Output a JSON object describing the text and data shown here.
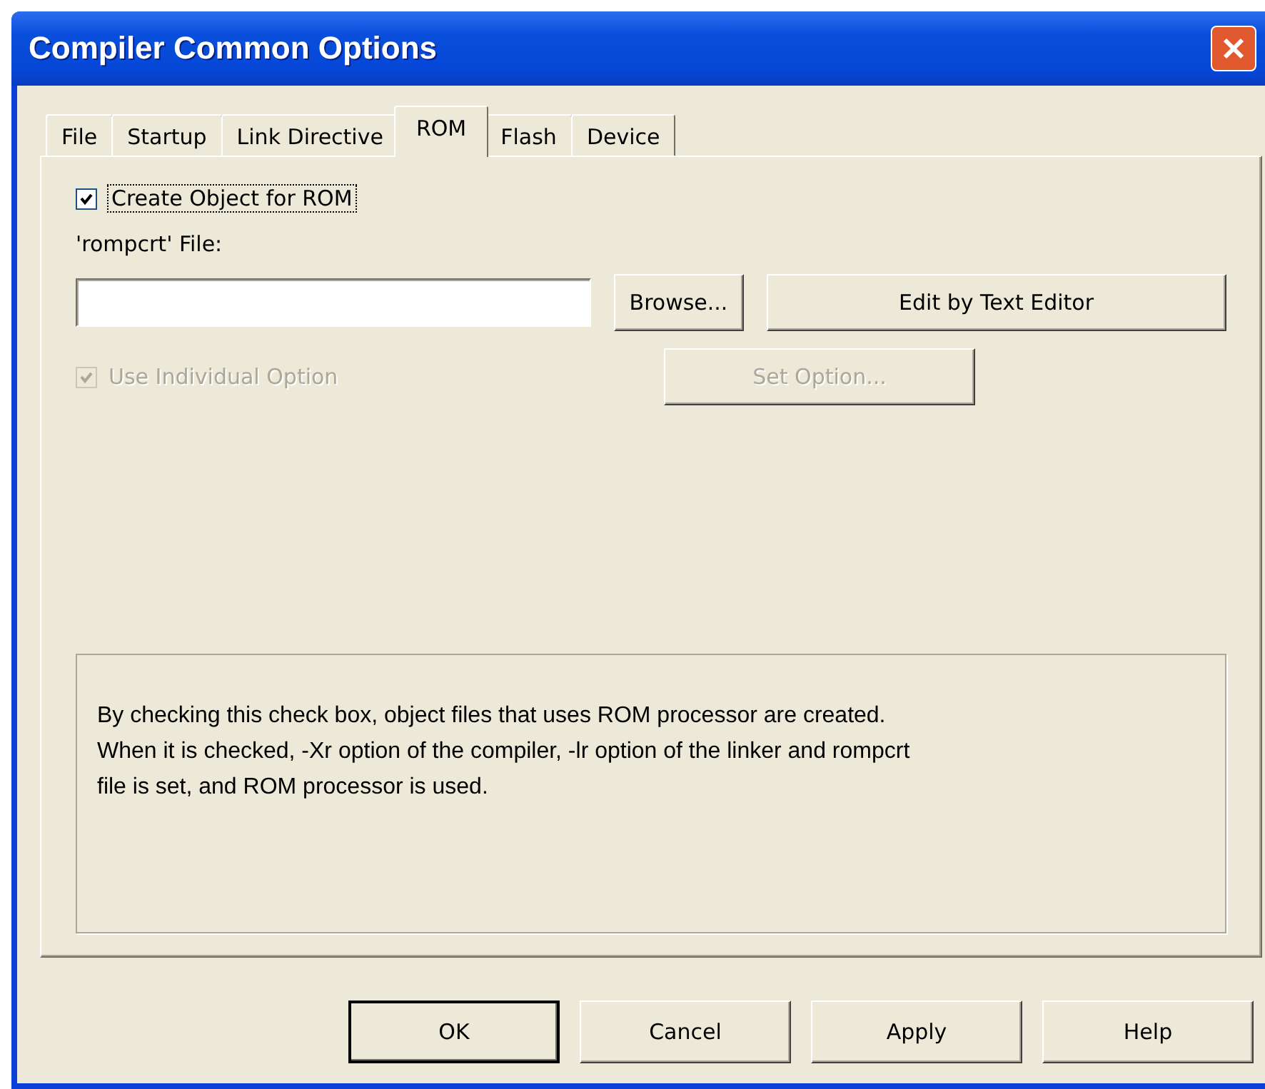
{
  "window": {
    "title": "Compiler Common Options"
  },
  "tabs": [
    {
      "label": "File",
      "selected": false
    },
    {
      "label": "Startup",
      "selected": false
    },
    {
      "label": "Link Directive",
      "selected": false
    },
    {
      "label": "ROM",
      "selected": true
    },
    {
      "label": "Flash",
      "selected": false
    },
    {
      "label": "Device",
      "selected": false
    }
  ],
  "create_object": {
    "label": "Create Object for ROM",
    "checked": true,
    "focused": true
  },
  "file_field": {
    "label": "'rompcrt' File:"
  },
  "file_buttons": [
    {
      "label": "Browse...",
      "disabled": false
    },
    {
      "label": "Edit by Text Editor",
      "disabled": false
    }
  ],
  "individual": {
    "label": "Use Individual Option",
    "checked": true,
    "disabled": true
  },
  "set_option": {
    "label": "Set Option...",
    "disabled": true
  },
  "description": "By checking this check box, object files that uses ROM processor are created.\nWhen it is checked, -Xr option of the compiler, -lr option of the linker and rompcrt\nfile is set, and ROM processor is used.",
  "buttons": [
    {
      "label": "OK",
      "default": true
    },
    {
      "label": "Cancel",
      "default": false
    },
    {
      "label": "Apply",
      "default": false
    },
    {
      "label": "Help",
      "default": false
    }
  ]
}
